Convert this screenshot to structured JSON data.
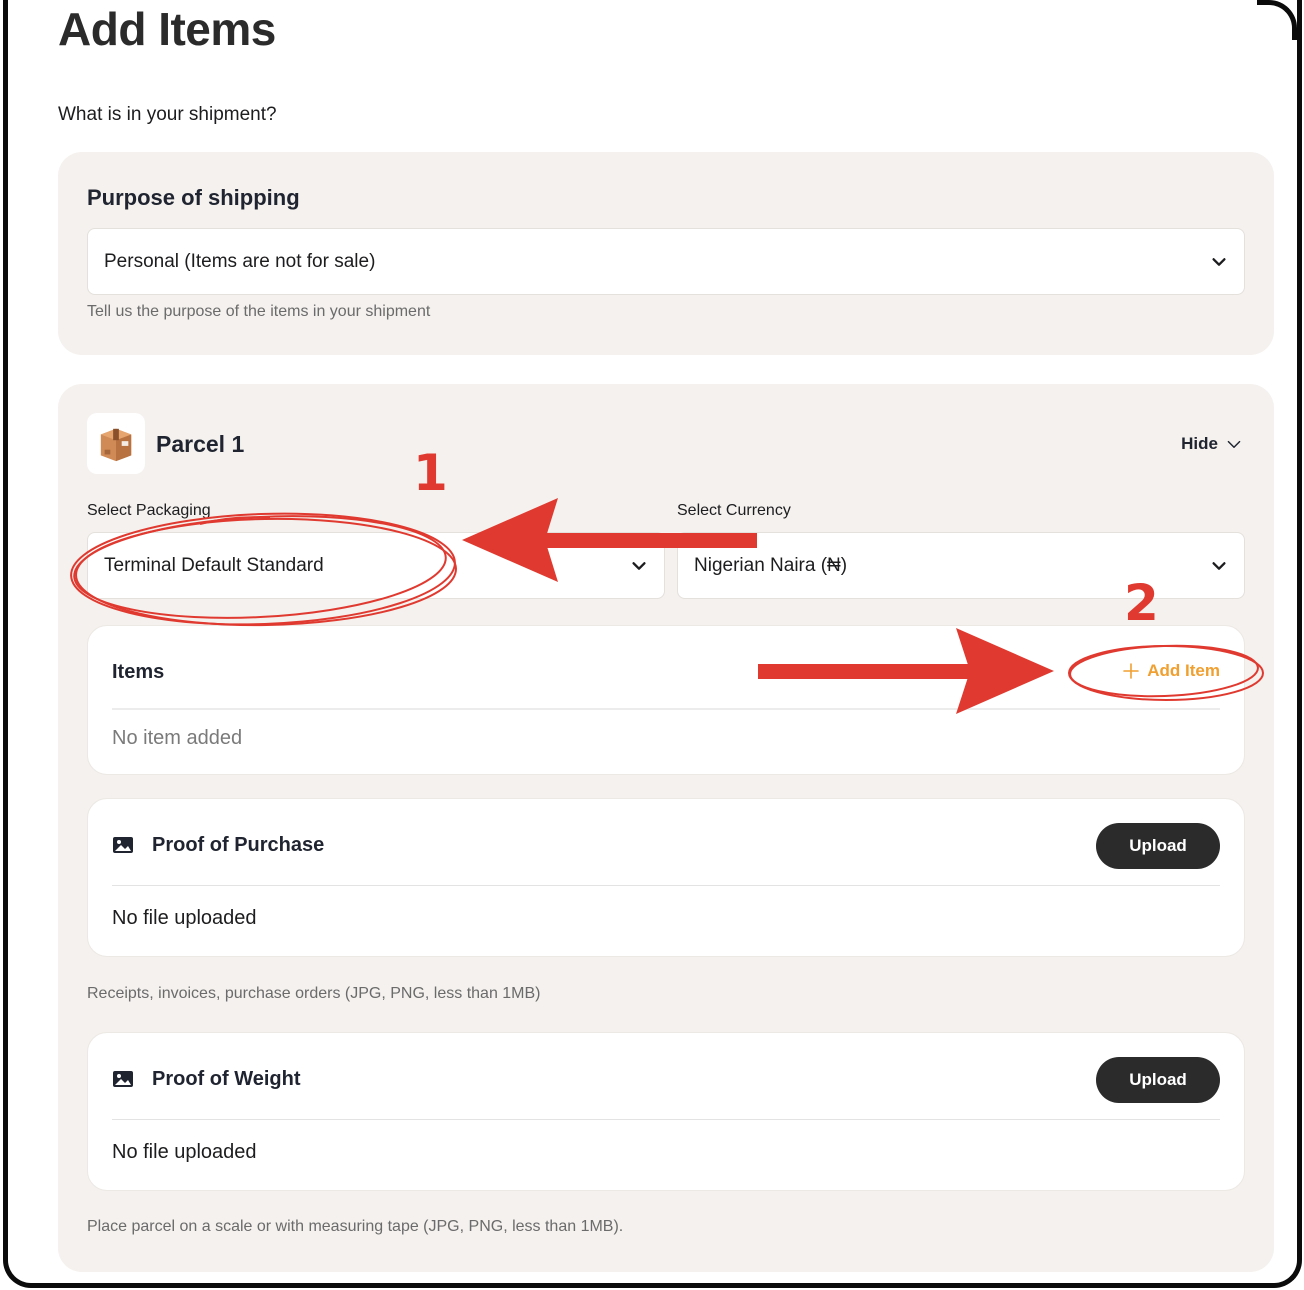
{
  "page": {
    "title": "Add Items",
    "subtitle": "What is in your shipment?"
  },
  "purpose": {
    "label": "Purpose of shipping",
    "selected": "Personal (Items are not for sale)",
    "help": "Tell us the purpose of the items in your shipment"
  },
  "parcel": {
    "title": "Parcel 1",
    "hide_label": "Hide",
    "packaging": {
      "label": "Select Packaging",
      "selected": "Terminal Default Standard"
    },
    "currency": {
      "label": "Select Currency",
      "selected": "Nigerian Naira (₦)"
    },
    "items": {
      "title": "Items",
      "add_label": "Add Item",
      "empty": "No item added"
    },
    "proof_purchase": {
      "title": "Proof of Purchase",
      "button": "Upload",
      "status": "No file uploaded",
      "help": "Receipts, invoices, purchase orders (JPG, PNG, less than 1MB)"
    },
    "proof_weight": {
      "title": "Proof of Weight",
      "button": "Upload",
      "status": "No file uploaded",
      "help": "Place parcel on a scale or with measuring tape (JPG, PNG, less than 1MB)."
    }
  },
  "annotations": {
    "step1": "1",
    "step2": "2",
    "color": "#e03a30"
  },
  "colors": {
    "accent": "#f0a030",
    "button": "#2b2b2b",
    "card_bg": "#f4f1ee"
  }
}
